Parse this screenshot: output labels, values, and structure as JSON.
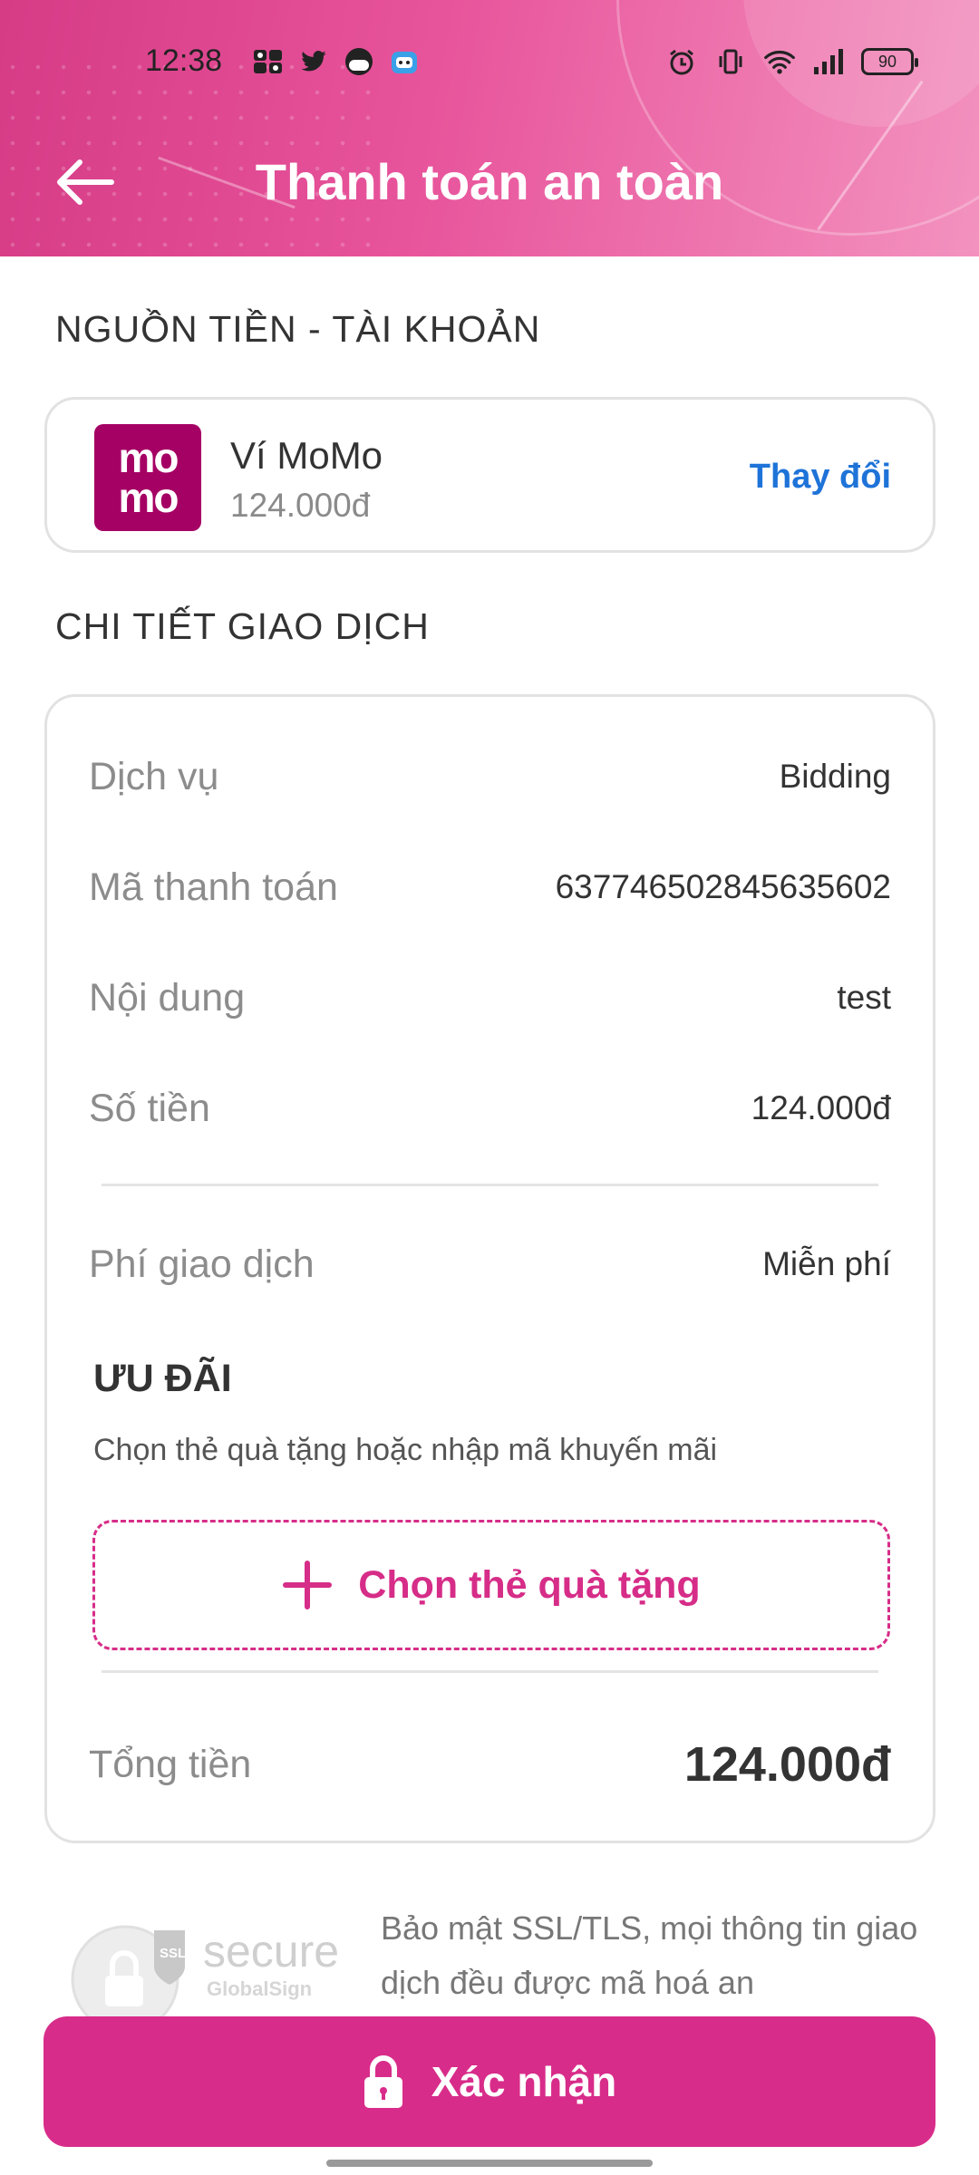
{
  "status_bar": {
    "time": "12:38",
    "battery": "90",
    "left_icons": [
      "mb-icon",
      "twitter-icon",
      "face-icon",
      "robot-icon"
    ],
    "right_icons": [
      "alarm-icon",
      "vibrate-icon",
      "wifi-icon",
      "signal-icon"
    ]
  },
  "header": {
    "title": "Thanh toán an toàn",
    "back_icon": "arrow-left-icon",
    "gradient": [
      "#d63b86",
      "#f392bf"
    ]
  },
  "source": {
    "section_title": "NGUỒN TIỀN - TÀI KHOẢN",
    "logo_line1": "mo",
    "logo_line2": "mo",
    "wallet_name": "Ví MoMo",
    "balance": "124.000đ",
    "change_label": "Thay đổi",
    "logo_color": "#a50064"
  },
  "details": {
    "section_title": "CHI TIẾT GIAO DỊCH",
    "rows": [
      {
        "label": "Dịch vụ",
        "value": "Bidding"
      },
      {
        "label": "Mã thanh toán",
        "value": "637746502845635602"
      },
      {
        "label": "Nội dung",
        "value": "test"
      },
      {
        "label": "Số tiền",
        "value": "124.000đ"
      }
    ],
    "fee_label": "Phí giao dịch",
    "fee_value": "Miễn phí",
    "promo_title": "ƯU ĐÃI",
    "promo_subtitle": "Chọn thẻ quà tặng hoặc nhập mã khuyến mãi",
    "gift_button_label": "Chọn thẻ quà tặng",
    "total_label": "Tổng tiền",
    "total_value": "124.000đ"
  },
  "security": {
    "badge_text": "secure",
    "badge_ssl": "SSL",
    "badge_sub": "GlobalSign",
    "text": "Bảo mật SSL/TLS, mọi thông tin giao dịch đều được mã hoá an"
  },
  "confirm_button": {
    "label": "Xác nhận",
    "color": "#d82c8a"
  }
}
